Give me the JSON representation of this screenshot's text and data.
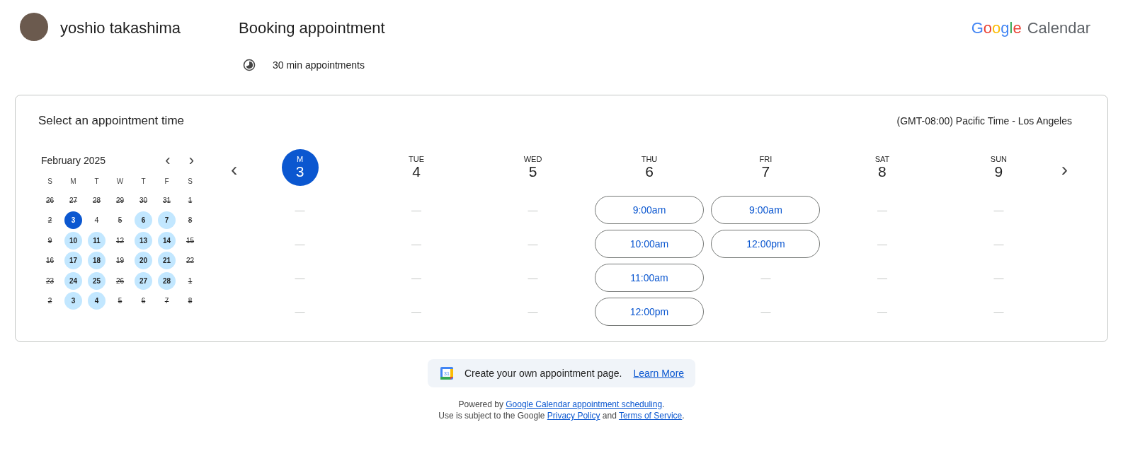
{
  "header": {
    "host_name": "yoshio takashima",
    "title": "Booking appointment",
    "duration": "30 min appointments",
    "logo": {
      "brand": "Google",
      "product": "Calendar"
    }
  },
  "card": {
    "heading": "Select an appointment time",
    "timezone": "(GMT-08:00) Pacific Time - Los Angeles",
    "mini_calendar": {
      "month": "February 2025",
      "prev": "‹",
      "next": "›",
      "weekdays": [
        "S",
        "M",
        "T",
        "W",
        "T",
        "F",
        "S"
      ],
      "days": [
        {
          "label": "26",
          "available": false,
          "selected": false
        },
        {
          "label": "27",
          "available": false,
          "selected": false
        },
        {
          "label": "28",
          "available": false,
          "selected": false
        },
        {
          "label": "29",
          "available": false,
          "selected": false
        },
        {
          "label": "30",
          "available": false,
          "selected": false
        },
        {
          "label": "31",
          "available": false,
          "selected": false
        },
        {
          "label": "1",
          "available": false,
          "selected": false
        },
        {
          "label": "2",
          "available": false,
          "selected": false
        },
        {
          "label": "3",
          "available": true,
          "selected": true
        },
        {
          "label": "4",
          "available": false,
          "selected": false
        },
        {
          "label": "5",
          "available": false,
          "selected": false
        },
        {
          "label": "6",
          "available": true,
          "selected": false
        },
        {
          "label": "7",
          "available": true,
          "selected": false
        },
        {
          "label": "8",
          "available": false,
          "selected": false
        },
        {
          "label": "9",
          "available": false,
          "selected": false
        },
        {
          "label": "10",
          "available": true,
          "selected": false
        },
        {
          "label": "11",
          "available": true,
          "selected": false
        },
        {
          "label": "12",
          "available": false,
          "selected": false
        },
        {
          "label": "13",
          "available": true,
          "selected": false
        },
        {
          "label": "14",
          "available": true,
          "selected": false
        },
        {
          "label": "15",
          "available": false,
          "selected": false
        },
        {
          "label": "16",
          "available": false,
          "selected": false
        },
        {
          "label": "17",
          "available": true,
          "selected": false
        },
        {
          "label": "18",
          "available": true,
          "selected": false
        },
        {
          "label": "19",
          "available": false,
          "selected": false
        },
        {
          "label": "20",
          "available": true,
          "selected": false
        },
        {
          "label": "21",
          "available": true,
          "selected": false
        },
        {
          "label": "22",
          "available": false,
          "selected": false
        },
        {
          "label": "23",
          "available": false,
          "selected": false
        },
        {
          "label": "24",
          "available": true,
          "selected": false
        },
        {
          "label": "25",
          "available": true,
          "selected": false
        },
        {
          "label": "26",
          "available": false,
          "selected": false
        },
        {
          "label": "27",
          "available": true,
          "selected": false
        },
        {
          "label": "28",
          "available": true,
          "selected": false
        },
        {
          "label": "1",
          "available": false,
          "selected": false
        },
        {
          "label": "2",
          "available": false,
          "selected": false
        },
        {
          "label": "3",
          "available": true,
          "selected": false
        },
        {
          "label": "4",
          "available": true,
          "selected": false
        },
        {
          "label": "5",
          "available": false,
          "selected": false
        },
        {
          "label": "6",
          "available": false,
          "selected": false
        },
        {
          "label": "7",
          "available": false,
          "selected": false
        },
        {
          "label": "8",
          "available": false,
          "selected": false
        }
      ]
    },
    "week": {
      "days": [
        {
          "weekday": "M",
          "date": "3",
          "selected": true,
          "slots": [
            {
              "kind": "empty",
              "label": "—"
            },
            {
              "kind": "empty",
              "label": "—"
            },
            {
              "kind": "empty",
              "label": "—"
            },
            {
              "kind": "empty",
              "label": "—"
            }
          ]
        },
        {
          "weekday": "TUE",
          "date": "4",
          "selected": false,
          "slots": [
            {
              "kind": "empty",
              "label": "—"
            },
            {
              "kind": "empty",
              "label": "—"
            },
            {
              "kind": "empty",
              "label": "—"
            },
            {
              "kind": "empty",
              "label": "—"
            }
          ]
        },
        {
          "weekday": "WED",
          "date": "5",
          "selected": false,
          "slots": [
            {
              "kind": "empty",
              "label": "—"
            },
            {
              "kind": "empty",
              "label": "—"
            },
            {
              "kind": "empty",
              "label": "—"
            },
            {
              "kind": "empty",
              "label": "—"
            }
          ]
        },
        {
          "weekday": "THU",
          "date": "6",
          "selected": false,
          "slots": [
            {
              "kind": "time",
              "label": "9:00am"
            },
            {
              "kind": "time",
              "label": "10:00am"
            },
            {
              "kind": "time",
              "label": "11:00am"
            },
            {
              "kind": "time",
              "label": "12:00pm"
            }
          ]
        },
        {
          "weekday": "FRI",
          "date": "7",
          "selected": false,
          "slots": [
            {
              "kind": "time",
              "label": "9:00am"
            },
            {
              "kind": "time",
              "label": "12:00pm"
            },
            {
              "kind": "empty",
              "label": "—"
            },
            {
              "kind": "empty",
              "label": "—"
            }
          ]
        },
        {
          "weekday": "SAT",
          "date": "8",
          "selected": false,
          "slots": [
            {
              "kind": "empty",
              "label": "—"
            },
            {
              "kind": "empty",
              "label": "—"
            },
            {
              "kind": "empty",
              "label": "—"
            },
            {
              "kind": "empty",
              "label": "—"
            }
          ]
        },
        {
          "weekday": "SUN",
          "date": "9",
          "selected": false,
          "slots": [
            {
              "kind": "empty",
              "label": "—"
            },
            {
              "kind": "empty",
              "label": "—"
            },
            {
              "kind": "empty",
              "label": "—"
            },
            {
              "kind": "empty",
              "label": "—"
            }
          ]
        }
      ],
      "prev": "‹",
      "next": "›"
    }
  },
  "promo": {
    "icon_label": "31",
    "text": "Create your own appointment page.",
    "link": "Learn More"
  },
  "footer": {
    "lines": [
      [
        {
          "text": "Powered by ",
          "link": false
        },
        {
          "text": "Google Calendar appointment scheduling",
          "link": true
        },
        {
          "text": ".",
          "link": false
        }
      ],
      [
        {
          "text": "Use is subject to the Google ",
          "link": false
        },
        {
          "text": "Privacy Policy",
          "link": true
        },
        {
          "text": " and ",
          "link": false
        },
        {
          "text": "Terms of Service",
          "link": true
        },
        {
          "text": ".",
          "link": false
        }
      ]
    ]
  }
}
